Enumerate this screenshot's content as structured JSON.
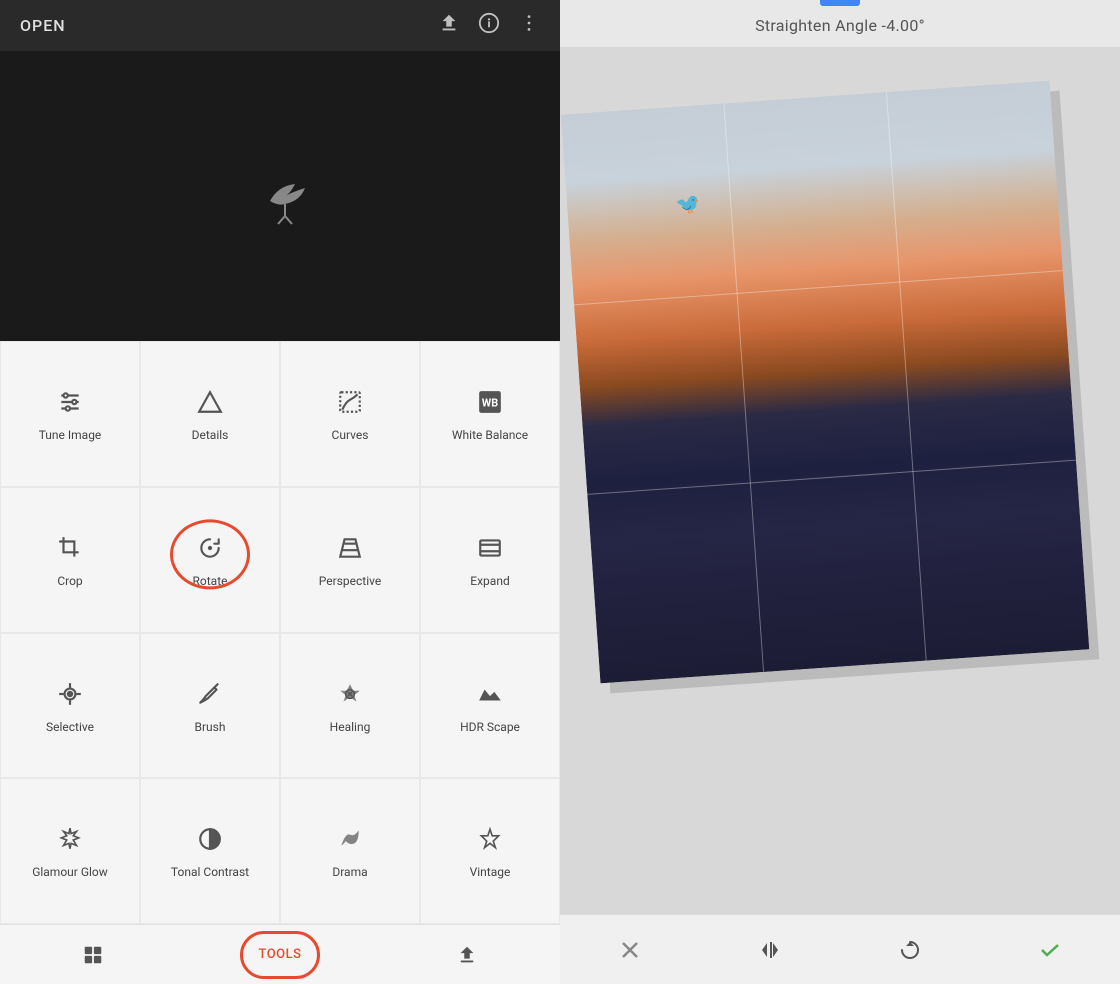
{
  "header": {
    "open_label": "OPEN",
    "icons": [
      "export-icon",
      "info-icon",
      "more-icon"
    ]
  },
  "straighten": {
    "label": "Straighten Angle -4.00°"
  },
  "tools": [
    {
      "id": "tune-image",
      "label": "Tune Image",
      "icon": "sliders"
    },
    {
      "id": "details",
      "label": "Details",
      "icon": "triangle"
    },
    {
      "id": "curves",
      "label": "Curves",
      "icon": "curves"
    },
    {
      "id": "white-balance",
      "label": "White Balance",
      "icon": "wb"
    },
    {
      "id": "crop",
      "label": "Crop",
      "icon": "crop"
    },
    {
      "id": "rotate",
      "label": "Rotate",
      "icon": "rotate",
      "active": true
    },
    {
      "id": "perspective",
      "label": "Perspective",
      "icon": "perspective"
    },
    {
      "id": "expand",
      "label": "Expand",
      "icon": "expand"
    },
    {
      "id": "selective",
      "label": "Selective",
      "icon": "selective"
    },
    {
      "id": "brush",
      "label": "Brush",
      "icon": "brush"
    },
    {
      "id": "healing",
      "label": "Healing",
      "icon": "healing"
    },
    {
      "id": "hdr-scape",
      "label": "HDR Scape",
      "icon": "hdr"
    },
    {
      "id": "glamour-glow",
      "label": "Glamour Glow",
      "icon": "glamour"
    },
    {
      "id": "tonal-contrast",
      "label": "Tonal Contrast",
      "icon": "tonal"
    },
    {
      "id": "drama",
      "label": "Drama",
      "icon": "drama"
    },
    {
      "id": "vintage",
      "label": "Vintage",
      "icon": "vintage"
    }
  ],
  "bottom_nav": [
    {
      "id": "looks",
      "label": "LOOKS",
      "type": "icon"
    },
    {
      "id": "tools",
      "label": "TOOLS",
      "type": "text",
      "active": true
    },
    {
      "id": "export",
      "label": "EXPORT",
      "type": "icon"
    }
  ],
  "action_bar": {
    "cancel_label": "✕",
    "flip_label": "⊣",
    "rotate_cw_label": "↻",
    "confirm_label": "✓"
  },
  "colors": {
    "accent_red": "#e84a2f",
    "blue_indicator": "#4285f4",
    "confirm_green": "#4caf50"
  }
}
